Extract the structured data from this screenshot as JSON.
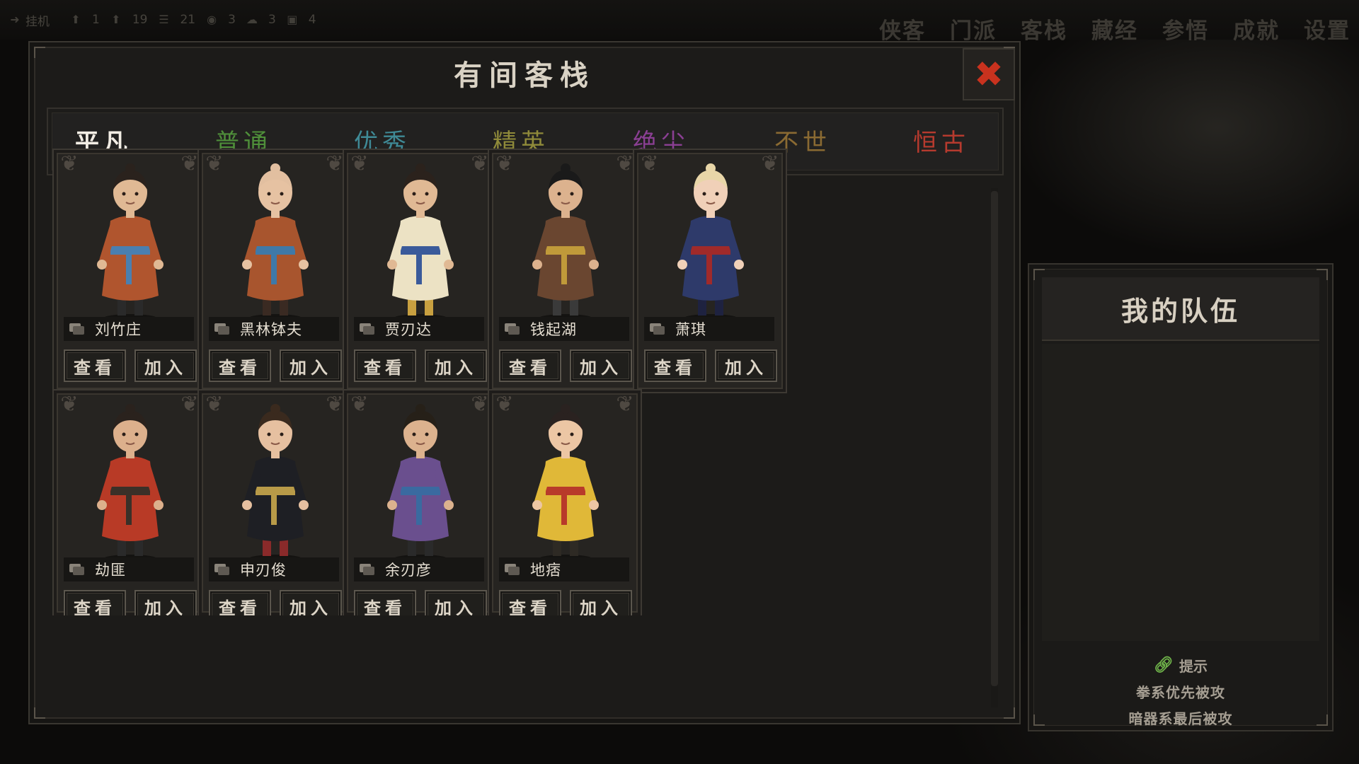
{
  "top_bar": {
    "stats": [
      {
        "icon": "arrow-icon",
        "label": "挂机",
        "value": ""
      },
      {
        "icon": "arrow-up-icon",
        "label": "",
        "value": "1"
      },
      {
        "icon": "arrow-up-icon",
        "label": "",
        "value": "19"
      },
      {
        "icon": "list-icon",
        "label": "",
        "value": "21"
      },
      {
        "icon": "coin-icon",
        "label": "",
        "value": "3"
      },
      {
        "icon": "cloud-icon",
        "label": "",
        "value": "3"
      },
      {
        "icon": "gift-icon",
        "label": "",
        "value": "4"
      }
    ],
    "nav": [
      "侠客",
      "门派",
      "客栈",
      "藏经",
      "参悟",
      "成就",
      "设置"
    ]
  },
  "panel": {
    "title": "有间客栈",
    "close_label": "✖"
  },
  "tabs": [
    {
      "label": "平凡",
      "color": "#f2ede4",
      "active": true
    },
    {
      "label": "普通",
      "color": "#4f8f3a",
      "active": false
    },
    {
      "label": "优秀",
      "color": "#3f8a96",
      "active": false
    },
    {
      "label": "精英",
      "color": "#8f8a3a",
      "active": false
    },
    {
      "label": "绝尘",
      "color": "#8a3f93",
      "active": false
    },
    {
      "label": "不世",
      "color": "#8a6a32",
      "active": false
    },
    {
      "label": "恒古",
      "color": "#b63a2e",
      "active": false
    }
  ],
  "heroes": [
    {
      "name": "刘竹庄",
      "view": "查看",
      "join": "加入",
      "hair": "#2a221d",
      "robe": "#b0552e",
      "sash": "#4a7fb0",
      "skin": "#e0b994",
      "shoe": "#2a2a2a"
    },
    {
      "name": "黑林钵夫",
      "view": "查看",
      "join": "加入",
      "hair": "#e2bfa0",
      "robe": "#a8552e",
      "sash": "#3f79a8",
      "skin": "#e6c2a2",
      "shoe": "#3a2a22"
    },
    {
      "name": "贾刃达",
      "view": "查看",
      "join": "加入",
      "hair": "#2b221c",
      "robe": "#ece2c4",
      "sash": "#3a5a9a",
      "skin": "#e0b994",
      "shoe": "#c8a040"
    },
    {
      "name": "钱起湖",
      "view": "查看",
      "join": "加入",
      "hair": "#1a1a1a",
      "robe": "#6a4630",
      "sash": "#c09a3a",
      "skin": "#dcb28e",
      "shoe": "#3a3a3a"
    },
    {
      "name": "萧琪",
      "view": "查看",
      "join": "加入",
      "hair": "#e8d6a8",
      "robe": "#2e3a6a",
      "sash": "#a02a2a",
      "skin": "#f0d0b8",
      "shoe": "#1e2240"
    },
    {
      "name": "劫匪",
      "view": "查看",
      "join": "加入",
      "hair": "#2a221d",
      "robe": "#b83a26",
      "sash": "#3a3028",
      "skin": "#dcb08c",
      "shoe": "#2a2a2a"
    },
    {
      "name": "申刃俊",
      "view": "查看",
      "join": "加入",
      "hair": "#3a2a1e",
      "robe": "#1e1f24",
      "sash": "#b89a48",
      "skin": "#e6c0a0",
      "shoe": "#8a2a2a"
    },
    {
      "name": "余刃彦",
      "view": "查看",
      "join": "加入",
      "hair": "#262018",
      "robe": "#6a4f8e",
      "sash": "#3a6aa0",
      "skin": "#dcb28e",
      "shoe": "#2a2a2a"
    },
    {
      "name": "地痞",
      "view": "查看",
      "join": "加入",
      "hair": "#2a2220",
      "robe": "#e0b838",
      "sash": "#b83a2a",
      "skin": "#ecc6a4",
      "shoe": "#2e2a24"
    }
  ],
  "team": {
    "title": "我的队伍",
    "tip_title": "提示",
    "tip_lines": [
      "拳系优先被攻",
      "暗器系最后被攻"
    ]
  }
}
